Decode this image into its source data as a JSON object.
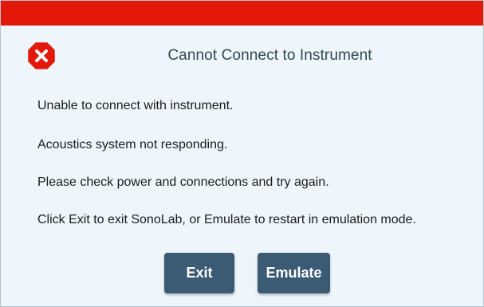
{
  "dialog": {
    "title": "Cannot Connect to Instrument",
    "icon": "error-icon",
    "messages": [
      "Unable to connect with instrument.",
      "Acoustics system not responding.",
      "Please check power and connections and try again.",
      "Click Exit to exit SonoLab, or Emulate to restart in emulation mode."
    ],
    "buttons": {
      "exit_label": "Exit",
      "emulate_label": "Emulate"
    }
  },
  "colors": {
    "title_bar": "#e3170a",
    "background": "#eef5fb",
    "button": "#3b5b74",
    "error_icon": "#e3170a"
  }
}
